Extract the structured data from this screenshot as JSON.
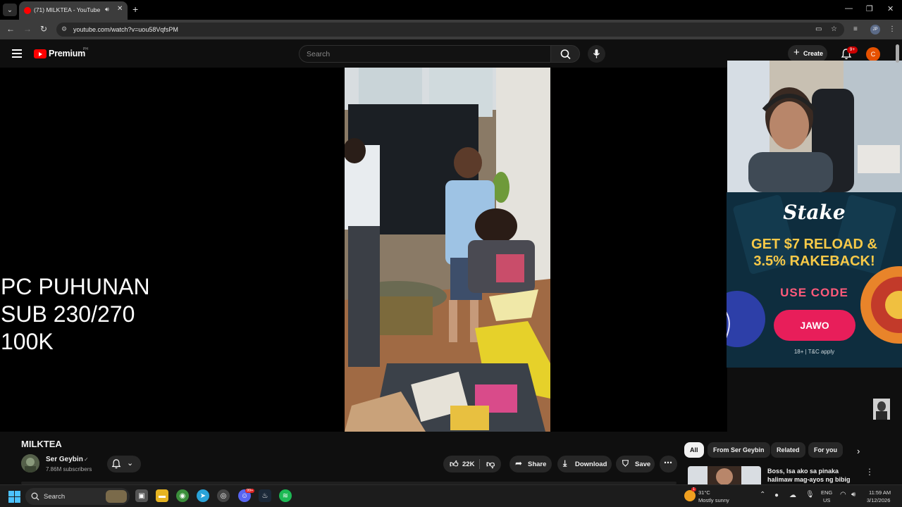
{
  "browser": {
    "tab_title": "(71) MILKTEA - YouTube",
    "url": "youtube.com/watch?v=uou58VqfsPM",
    "profile_initials": "JP"
  },
  "youtube": {
    "logo_text": "Premium",
    "logo_region": "PH",
    "search_placeholder": "Search",
    "create_label": "Create",
    "notification_badge": "9+",
    "avatar_initial": "C"
  },
  "overlay": {
    "lines": [
      "PC PUHUNAN",
      "SUB 230/270",
      "100K"
    ]
  },
  "ad": {
    "brand": "Stake",
    "headline_line1": "GET $7 RELOAD &",
    "headline_line2": "3.5% RAKEBACK!",
    "use_code_label": "USE CODE",
    "code": "JAWO",
    "fine_print": "18+ | T&C apply"
  },
  "video": {
    "title": "MILKTEA",
    "channel_name": "Ser Geybin",
    "subscribers": "7.86M subscribers",
    "likes": "22K",
    "share_label": "Share",
    "download_label": "Download",
    "save_label": "Save"
  },
  "chips": [
    "All",
    "From Ser Geybin",
    "Related",
    "For you"
  ],
  "related": {
    "title_line1": "Boss, Isa ako sa pinaka",
    "title_line2": "halimaw mag-ayos ng bibig"
  },
  "taskbar": {
    "search_label": "Search",
    "weather_temp": "31°C",
    "weather_desc": "Mostly sunny",
    "weather_badge": "1",
    "lang1": "ENG",
    "lang2": "US",
    "time": "11:59 AM",
    "date": "3/12/2026",
    "discord_badge": "99+"
  },
  "colors": {
    "youtube_red": "#ff0000",
    "ad_button": "#e81e5a",
    "ad_headline": "#f7c948",
    "avatar_orange": "#e65100"
  }
}
